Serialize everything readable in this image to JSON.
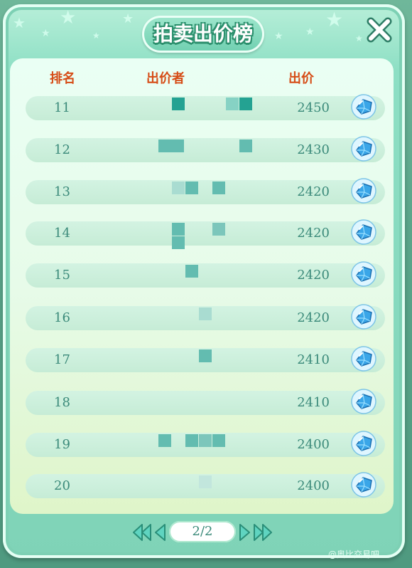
{
  "title": "拍卖出价榜",
  "columns": {
    "rank": "排名",
    "bidder": "出价者",
    "bid": "出价"
  },
  "rows": [
    {
      "rank": "11",
      "bid": "2450"
    },
    {
      "rank": "12",
      "bid": "2430"
    },
    {
      "rank": "13",
      "bid": "2420"
    },
    {
      "rank": "14",
      "bid": "2420"
    },
    {
      "rank": "15",
      "bid": "2420"
    },
    {
      "rank": "16",
      "bid": "2420"
    },
    {
      "rank": "17",
      "bid": "2410"
    },
    {
      "rank": "18",
      "bid": "2410"
    },
    {
      "rank": "19",
      "bid": "2400"
    },
    {
      "rank": "20",
      "bid": "2400"
    }
  ],
  "pagination": {
    "label": "2/2"
  },
  "watermark": "@奥比交易吧",
  "icons": {
    "close": "close-x-icon",
    "currency": "diamond-gem-icon",
    "first": "double-left-arrow-icon",
    "prev": "left-arrow-icon",
    "next": "right-arrow-icon",
    "last": "double-right-arrow-icon"
  },
  "colors": {
    "header_text": "#d64c16",
    "row_text": "#3b8a7a",
    "panel": "#7fd3b7",
    "title_outline": "#2c8f6d"
  }
}
